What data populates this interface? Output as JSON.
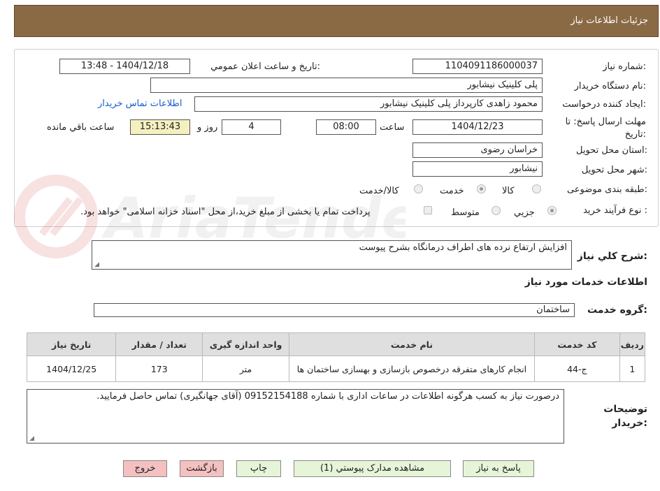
{
  "header": {
    "title": "جزئیات اطلاعات نیاز"
  },
  "form": {
    "need_number_label": "شماره نیاز:",
    "need_number": "1104091186000037",
    "announce_label": "تاریخ و ساعت اعلان عمومي:",
    "announce_value": "1404/12/18 - 13:48",
    "buyer_org_label": "نام دستگاه خريدار:",
    "buyer_org": "پلی کلینیک نیشابور",
    "requester_label": "ايجاد كننده درخواست:",
    "requester": "محمود زاهدی کارپرداز پلی کلینیک نیشابور",
    "contact_link": "اطلاعات تماس خريدار",
    "deadline_label": "مهلت ارسال پاسخ: تا تاریخ:",
    "deadline_date": "1404/12/23",
    "time_label": "ساعت",
    "deadline_time": "08:00",
    "days": "4",
    "days_label": "روز و",
    "remaining_time": "15:13:43",
    "remaining_label": "ساعت باقي مانده",
    "province_label": "استان محل تحویل:",
    "province": "خراسان رضوی",
    "city_label": "شهر محل تحویل:",
    "city": "نیشابور",
    "category_label": "طبقه بندی موضوعی:",
    "category_options": [
      "کالا",
      "خدمت",
      "کالا/خدمت"
    ],
    "category_selected": "خدمت",
    "process_label": "نوع فرآیند خرید :",
    "process_options": [
      "جزيي",
      "متوسط"
    ],
    "process_selected": "جزيي",
    "payment_note": "پرداخت تمام یا بخشی از مبلغ خرید،از محل \"اسناد خزانه اسلامی\" خواهد بود."
  },
  "description": {
    "label": "شرح كلي نياز:",
    "value": "افزایش ارتفاع نرده های اطراف درمانگاه بشرح پیوست"
  },
  "services": {
    "section_title": "اطلاعات خدمات مورد نياز",
    "group_label": "گروه خدمت:",
    "group_value": "ساختمان",
    "columns": [
      "رديف",
      "كد خدمت",
      "نام خدمت",
      "واحد اندازه گيری",
      "تعداد / مقدار",
      "تاريخ نياز"
    ],
    "rows": [
      [
        "1",
        "ج-44",
        "انجام کارهای متفرقه درخصوص بازسازی و بهسازی ساختمان ها",
        "متر",
        "173",
        "1404/12/25"
      ]
    ]
  },
  "buyer_notes": {
    "label": "توضيحات خريدار:",
    "value": "درصورت نیاز به کسب هرگونه اطلاعات در ساعات اداری با شماره 09152154188 (آقای جهانگیری) تماس حاصل فرمایید."
  },
  "buttons": {
    "reply": "پاسخ به نياز",
    "attachments": "مشاهده مدارک پيوستي (1)",
    "print": "چاپ",
    "back": "بازگشت",
    "exit": "خروج"
  },
  "colors": {
    "header": "#8a6a45",
    "link": "#1a5ccc",
    "green_button": "#e6f5d8",
    "red_button": "#f4c0c0",
    "remaining_bg": "#f5f0c0"
  }
}
